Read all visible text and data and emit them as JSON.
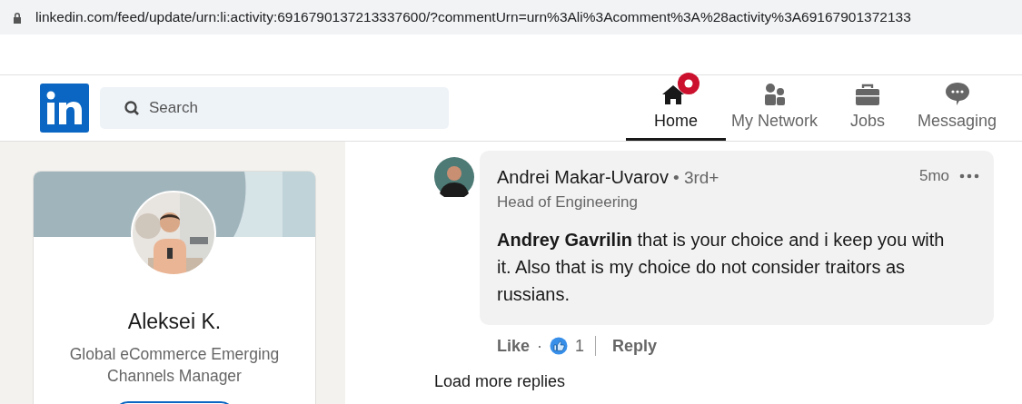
{
  "browser": {
    "url": "linkedin.com/feed/update/urn:li:activity:6916790137213337600/?commentUrn=urn%3Ali%3Acomment%3A%28activity%3A69167901372133"
  },
  "search": {
    "placeholder": "Search"
  },
  "nav": [
    {
      "label": "Home",
      "kind": "home",
      "selected": true,
      "notification": true
    },
    {
      "label": "My Network",
      "kind": "network",
      "selected": false,
      "notification": false
    },
    {
      "label": "Jobs",
      "kind": "jobs",
      "selected": false,
      "notification": false
    },
    {
      "label": "Messaging",
      "kind": "messaging",
      "selected": false,
      "notification": false
    }
  ],
  "profile": {
    "name": "Aleksei K.",
    "headline": "Global eCommerce Emerging Channels Manager"
  },
  "comment": {
    "author": "Andrei Makar-Uvarov",
    "degree": "• 3rd+",
    "headline": "Head of Engineering",
    "time": "5mo",
    "text": "**Andrey Gavrilin** that is your choice and i keep you with it. Also that is my choice do not consider traitors as russians.",
    "like": "Like",
    "separator": "·",
    "reactions": "1",
    "reply": "Reply"
  },
  "load_more": "Load more replies"
}
